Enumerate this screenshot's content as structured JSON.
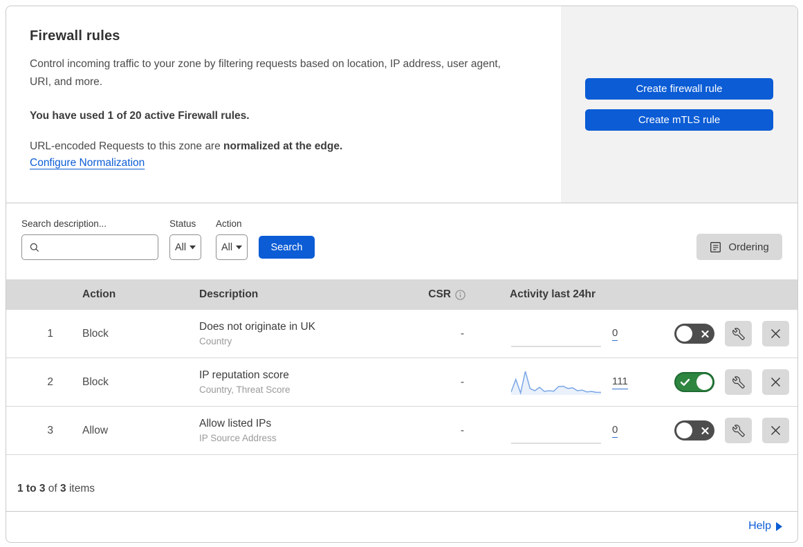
{
  "header": {
    "title": "Firewall rules",
    "description": "Control incoming traffic to your zone by filtering requests based on location, IP address, user agent, URI, and more.",
    "usage_line": "You have used 1 of 20 active Firewall rules.",
    "normalization_prefix": "URL-encoded Requests to this zone are ",
    "normalization_bold": "normalized at the edge.",
    "normalization_link": "Configure Normalization",
    "buttons": [
      {
        "label": "Create firewall rule"
      },
      {
        "label": "Create mTLS rule"
      }
    ]
  },
  "filters": {
    "search_label": "Search description...",
    "search_value": "",
    "status_label": "Status",
    "status_value": "All",
    "action_label": "Action",
    "action_value": "All",
    "search_button": "Search",
    "ordering_button": "Ordering"
  },
  "table": {
    "columns": {
      "action": "Action",
      "description": "Description",
      "csr": "CSR",
      "activity": "Activity last 24hr"
    },
    "rows": [
      {
        "index": "1",
        "action": "Block",
        "description": "Does not originate in UK",
        "fields": "Country",
        "csr": "-",
        "activity_count": "0",
        "enabled": false,
        "sparkline": []
      },
      {
        "index": "2",
        "action": "Block",
        "description": "IP reputation score",
        "fields": "Country, Threat Score",
        "csr": "-",
        "activity_count": "111",
        "enabled": true,
        "sparkline": [
          10,
          65,
          5,
          100,
          25,
          15,
          30,
          12,
          15,
          13,
          33,
          35,
          25,
          28,
          15,
          18,
          10,
          12,
          8,
          8
        ]
      },
      {
        "index": "3",
        "action": "Allow",
        "description": "Allow listed IPs",
        "fields": "IP Source Address",
        "csr": "-",
        "activity_count": "0",
        "enabled": false,
        "sparkline": []
      }
    ]
  },
  "footer": {
    "range": "1 to 3",
    "of_label": " of ",
    "total": "3",
    "items_label": " items",
    "help_label": "Help"
  },
  "colors": {
    "accent_blue": "#0b5cd5",
    "toggle_on_green": "#2e8540",
    "toggle_off_gray": "#4d4d4d",
    "sparkline_stroke": "#7aa7e6",
    "sparkline_fill": "#eaf1fb",
    "empty_sparkline_gray": "#c9c9c9",
    "table_header_gray": "#d9d9d9",
    "panel_gray": "#f2f2f2"
  }
}
